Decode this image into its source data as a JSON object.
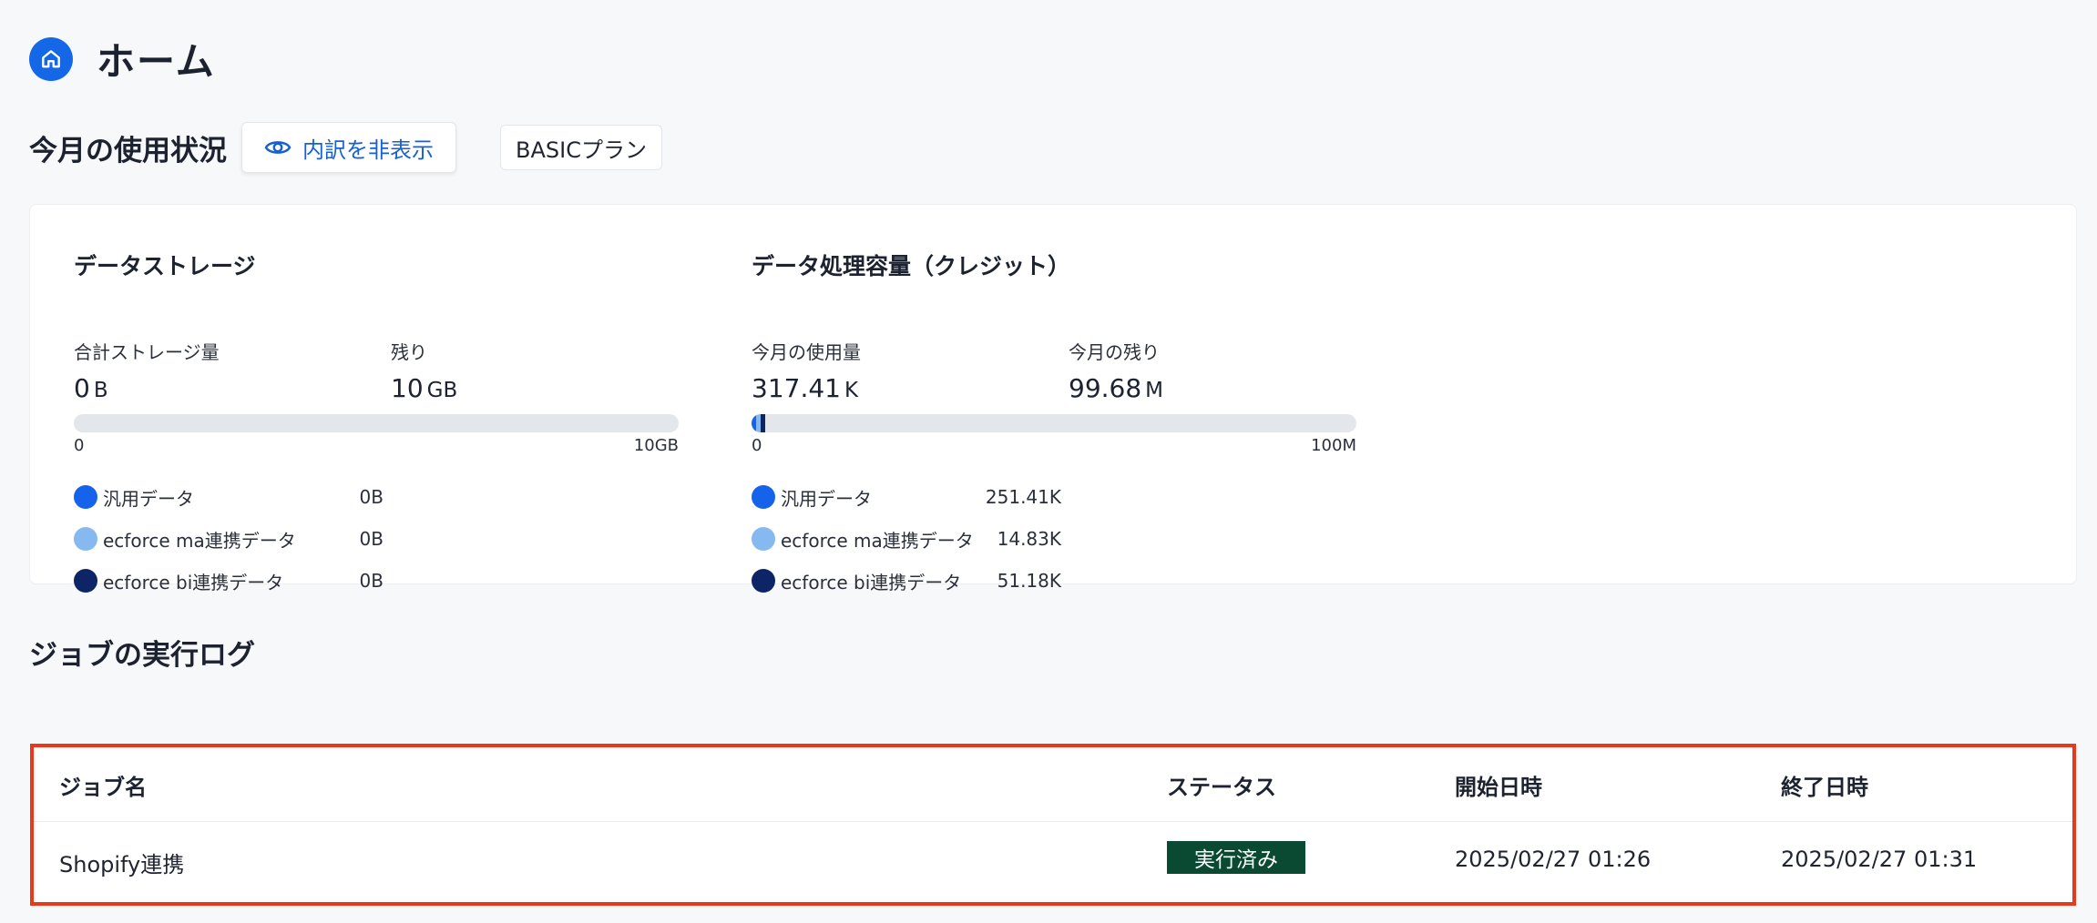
{
  "header": {
    "title": "ホーム",
    "icon": "home-icon"
  },
  "usage": {
    "title": "今月の使用状況",
    "toggle_label": "内訳を非表示",
    "plan_label": "BASICプラン",
    "storage": {
      "title": "データストレージ",
      "total_label": "合計ストレージ量",
      "total_value": "0",
      "total_unit": "B",
      "remaining_label": "残り",
      "remaining_value": "10",
      "remaining_unit": "GB",
      "bar_min": "0",
      "bar_max": "10GB",
      "legend": [
        {
          "label": "汎用データ",
          "value": "0B",
          "color": "#1463ea",
          "fraction": 0
        },
        {
          "label": "ecforce ma連携データ",
          "value": "0B",
          "color": "#86b9f0",
          "fraction": 0
        },
        {
          "label": "ecforce bi連携データ",
          "value": "0B",
          "color": "#0d2466",
          "fraction": 0
        }
      ]
    },
    "credit": {
      "title": "データ処理容量（クレジット）",
      "used_label": "今月の使用量",
      "used_value": "317.41",
      "used_unit": "K",
      "remaining_label": "今月の残り",
      "remaining_value": "99.68",
      "remaining_unit": "M",
      "bar_min": "0",
      "bar_max": "100M",
      "legend": [
        {
          "label": "汎用データ",
          "value": "251.41K",
          "color": "#1463ea",
          "fraction": 0.0025141
        },
        {
          "label": "ecforce ma連携データ",
          "value": "14.83K",
          "color": "#86b9f0",
          "fraction": 0.0001483
        },
        {
          "label": "ecforce bi連携データ",
          "value": "51.18K",
          "color": "#0d2466",
          "fraction": 0.0005118
        }
      ]
    }
  },
  "jobs": {
    "title": "ジョブの実行ログ",
    "columns": {
      "name": "ジョブ名",
      "status": "ステータス",
      "start": "開始日時",
      "end": "終了日時"
    },
    "rows": [
      {
        "name": "Shopify連携",
        "status": "実行済み",
        "start": "2025/02/27 01:26",
        "end": "2025/02/27 01:31"
      }
    ]
  }
}
